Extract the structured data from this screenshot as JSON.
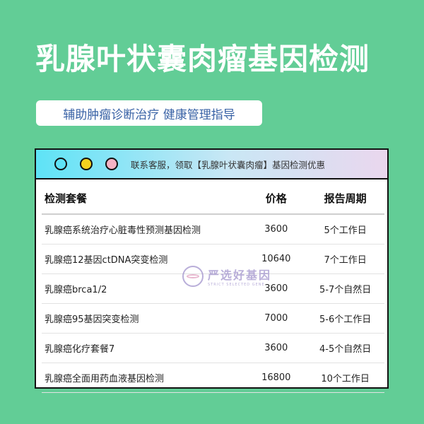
{
  "title": "乳腺叶状囊肉瘤基因检测",
  "subtitle": "辅助肿瘤诊断治疗 健康管理指导",
  "card": {
    "notice": "联系客服，领取【乳腺叶状囊肉瘤】基因检测优惠",
    "dot_colors": [
      "#5ee3f6",
      "#f5d21f",
      "#f5b3c4"
    ]
  },
  "table": {
    "headers": [
      "检测套餐",
      "价格",
      "报告周期"
    ],
    "rows": [
      {
        "name": "乳腺癌系统治疗心脏毒性预测基因检测",
        "price": "3600",
        "period": "5个工作日"
      },
      {
        "name": "乳腺癌12基因ctDNA突变检测",
        "price": "10640",
        "period": "7个工作日"
      },
      {
        "name": "乳腺癌brca1/2",
        "price": "3600",
        "period": "5-7个自然日"
      },
      {
        "name": "乳腺癌95基因突变检测",
        "price": "7000",
        "period": "5-6个工作日"
      },
      {
        "name": "乳腺癌化疗套餐7",
        "price": "3600",
        "period": "4-5个自然日"
      },
      {
        "name": "乳腺癌全面用药血液基因检测",
        "price": "16800",
        "period": "10个工作日"
      }
    ]
  },
  "watermark": {
    "text": "严选好基因",
    "sub": "STRICT SELECTED GENE"
  }
}
